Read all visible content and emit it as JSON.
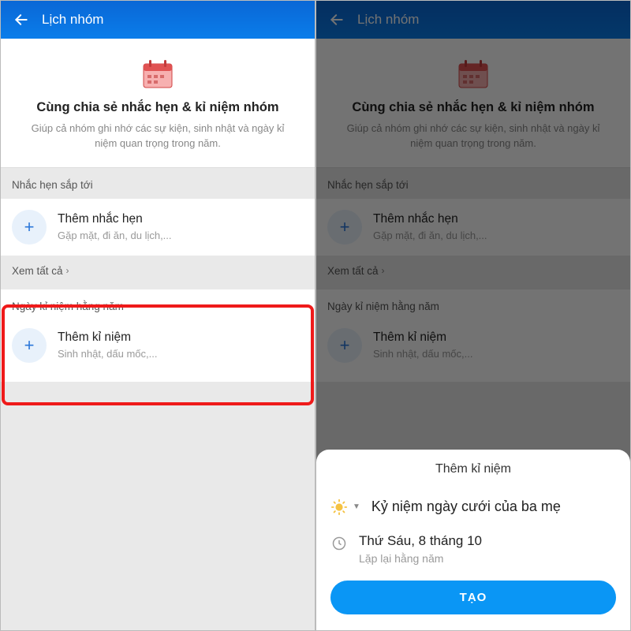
{
  "left": {
    "header_title": "Lịch nhóm",
    "intro_title": "Cùng chia sẻ nhắc hẹn & kỉ niệm nhóm",
    "intro_sub": "Giúp cả nhóm ghi nhớ các sự kiện, sinh nhật và ngày kỉ niệm quan trọng trong năm.",
    "upcoming_label": "Nhắc hẹn sắp tới",
    "add_reminder_title": "Thêm nhắc hẹn",
    "add_reminder_sub": "Gặp mặt, đi ăn, du lịch,...",
    "see_all": "Xem tất cả",
    "anniv_label": "Ngày kỉ niệm hằng năm",
    "add_anniv_title": "Thêm kỉ niệm",
    "add_anniv_sub": "Sinh nhật, dấu mốc,..."
  },
  "right": {
    "intro_title": "Cùng chia sẻ nhắc hẹn & kỉ niệm nhóm",
    "intro_sub": "Giúp cả nhóm ghi nhớ các sự kiện, sinh nhật và ngày kỉ niệm quan trọng trong năm.",
    "upcoming_label": "Nhắc hẹn sắp tới",
    "add_reminder_title": "Thêm nhắc hẹn",
    "add_reminder_sub": "Gặp mặt, đi ăn, du lịch,...",
    "see_all": "Xem tất cả",
    "anniv_label": "Ngày kỉ niệm hằng năm",
    "sheet_title": "Thêm kỉ niệm",
    "event_name": "Kỷ niệm ngày cưới của ba mẹ",
    "event_date": "Thứ Sáu, 8 tháng 10",
    "event_repeat": "Lặp lại hằng năm",
    "create_label": "TẠO"
  },
  "colors": {
    "highlight": "#ef1a1a",
    "primary": "#0a96f5"
  }
}
